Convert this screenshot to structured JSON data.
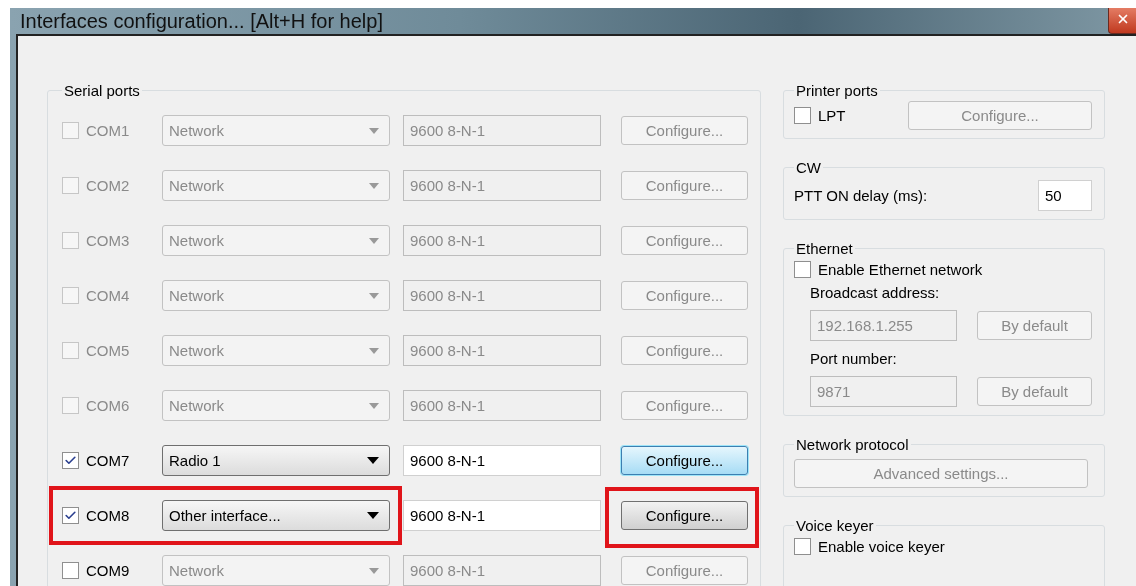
{
  "window": {
    "title": "Interfaces configuration... [Alt+H for help]"
  },
  "serial_ports": {
    "label": "Serial ports",
    "ports": [
      {
        "name": "COM1",
        "checked": false,
        "device": "Network",
        "settings": "9600 8-N-1",
        "button": "Configure...",
        "focused": false,
        "highlighted": false
      },
      {
        "name": "COM2",
        "checked": false,
        "device": "Network",
        "settings": "9600 8-N-1",
        "button": "Configure...",
        "focused": false,
        "highlighted": false
      },
      {
        "name": "COM3",
        "checked": false,
        "device": "Network",
        "settings": "9600 8-N-1",
        "button": "Configure...",
        "focused": false,
        "highlighted": false
      },
      {
        "name": "COM4",
        "checked": false,
        "device": "Network",
        "settings": "9600 8-N-1",
        "button": "Configure...",
        "focused": false,
        "highlighted": false
      },
      {
        "name": "COM5",
        "checked": false,
        "device": "Network",
        "settings": "9600 8-N-1",
        "button": "Configure...",
        "focused": false,
        "highlighted": false
      },
      {
        "name": "COM6",
        "checked": false,
        "device": "Network",
        "settings": "9600 8-N-1",
        "button": "Configure...",
        "focused": false,
        "highlighted": false
      },
      {
        "name": "COM7",
        "checked": true,
        "device": "Radio 1",
        "settings": "9600 8-N-1",
        "button": "Configure...",
        "focused": true,
        "highlighted": false
      },
      {
        "name": "COM8",
        "checked": true,
        "device": "Other interface...",
        "settings": "9600 8-N-1",
        "button": "Configure...",
        "focused": false,
        "highlighted": true
      },
      {
        "name": "COM9",
        "checked": false,
        "device": "Network",
        "settings": "9600 8-N-1",
        "button": "Configure...",
        "focused": false,
        "highlighted": false
      }
    ]
  },
  "printer_ports": {
    "label": "Printer ports",
    "lpt": {
      "label": "LPT",
      "checked": false
    },
    "button": "Configure..."
  },
  "cw": {
    "label": "CW",
    "ptt_label": "PTT ON delay (ms):",
    "ptt_value": "50"
  },
  "ethernet": {
    "label": "Ethernet",
    "enable": {
      "label": "Enable Ethernet network",
      "checked": false
    },
    "broadcast_label": "Broadcast address:",
    "broadcast_value": "192.168.1.255",
    "broadcast_button": "By default",
    "port_label": "Port number:",
    "port_value": "9871",
    "port_button": "By default"
  },
  "network_protocol": {
    "label": "Network protocol",
    "button": "Advanced settings...",
    "disabled": true
  },
  "voice_keyer": {
    "label": "Voice keyer",
    "enable": {
      "label": "Enable voice keyer",
      "checked": false
    }
  }
}
